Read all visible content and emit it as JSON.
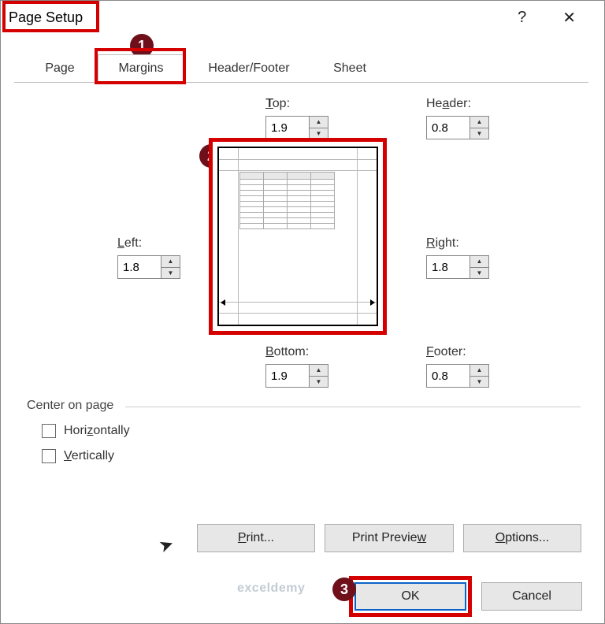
{
  "window": {
    "title": "Page Setup",
    "help": "?",
    "close": "✕"
  },
  "tabs": {
    "page": "Page",
    "margins": "Margins",
    "header_footer": "Header/Footer",
    "sheet": "Sheet"
  },
  "labels": {
    "top": "Top:",
    "header": "Header:",
    "left": "Left:",
    "right": "Right:",
    "bottom": "Bottom:",
    "footer": "Footer:"
  },
  "margins": {
    "top": "1.9",
    "header": "0.8",
    "left": "1.8",
    "right": "1.8",
    "bottom": "1.9",
    "footer": "0.8"
  },
  "center": {
    "section": "Center on page",
    "horizontally": "Horizontally",
    "vertically": "Vertically"
  },
  "buttons": {
    "print": "Print...",
    "preview": "Print Preview",
    "options": "Options...",
    "ok": "OK",
    "cancel": "Cancel"
  },
  "callouts": {
    "c1": "1",
    "c2": "2",
    "c3": "3"
  },
  "watermark": "exceldemy"
}
